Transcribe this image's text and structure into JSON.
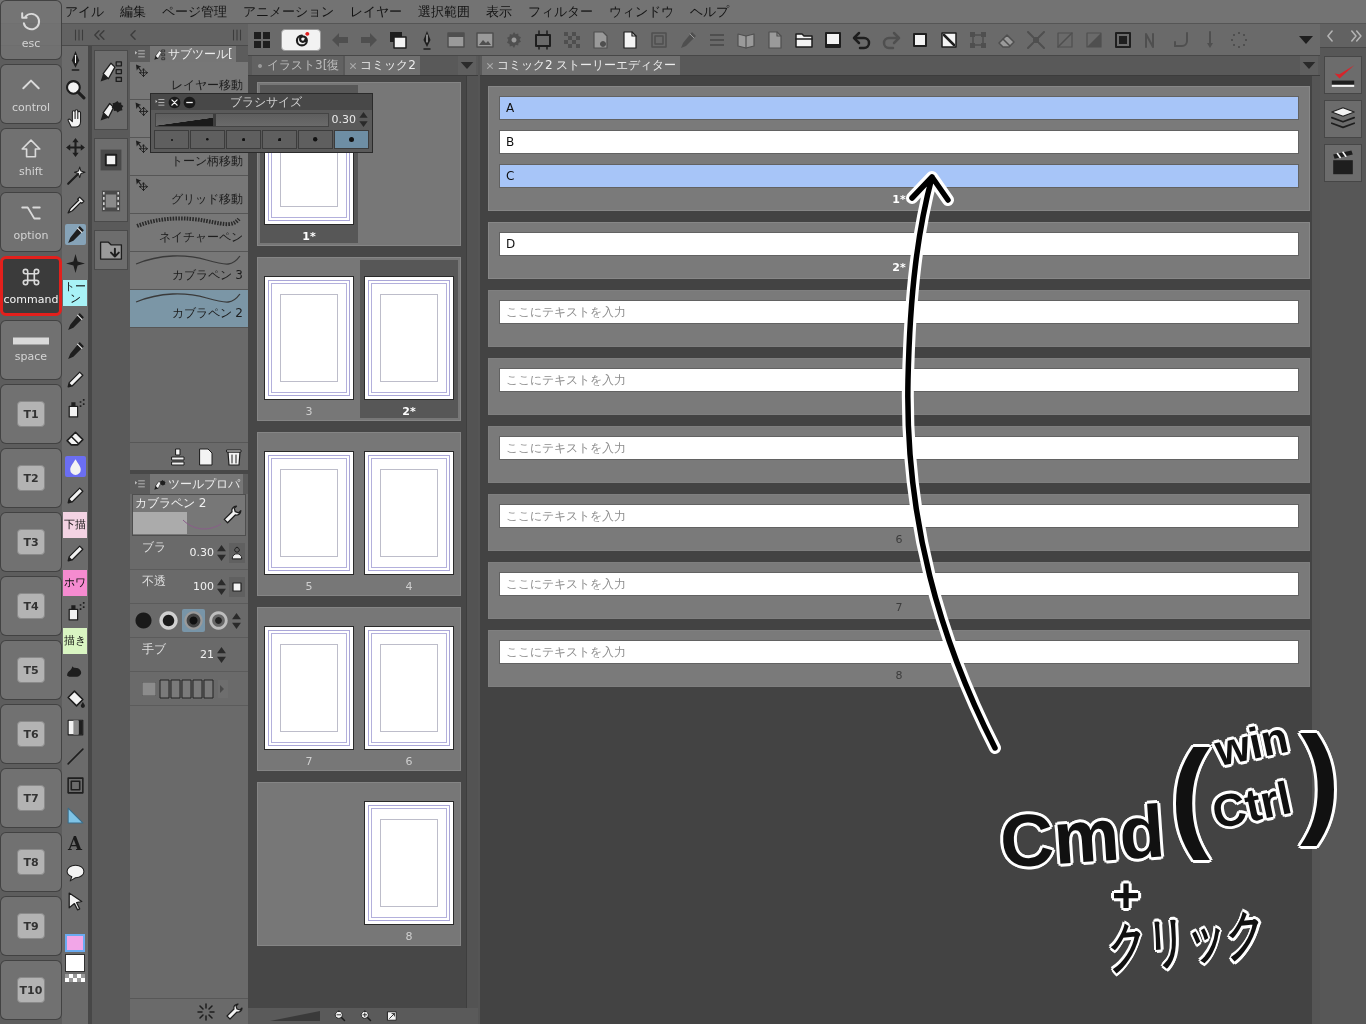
{
  "menu_bar": [
    "アイル",
    "編集",
    "ページ管理",
    "アニメーション",
    "レイヤー",
    "選択範囲",
    "表示",
    "フィルター",
    "ウィンドウ",
    "ヘルプ"
  ],
  "key_overlay": [
    {
      "kind": "esc",
      "label": "esc",
      "pressed": false
    },
    {
      "kind": "control",
      "label": "control",
      "pressed": false
    },
    {
      "kind": "shift",
      "label": "shift",
      "pressed": false
    },
    {
      "kind": "option",
      "label": "option",
      "pressed": false
    },
    {
      "kind": "command",
      "label": "command",
      "pressed": true
    },
    {
      "kind": "space",
      "label": "space",
      "pressed": false
    },
    {
      "kind": "slot",
      "label": "T1",
      "pressed": false
    },
    {
      "kind": "slot",
      "label": "T2",
      "pressed": false
    },
    {
      "kind": "slot",
      "label": "T3",
      "pressed": false
    },
    {
      "kind": "slot",
      "label": "T4",
      "pressed": false
    },
    {
      "kind": "slot",
      "label": "T5",
      "pressed": false
    },
    {
      "kind": "slot",
      "label": "T6",
      "pressed": false
    },
    {
      "kind": "slot",
      "label": "T7",
      "pressed": false
    },
    {
      "kind": "slot",
      "label": "T8",
      "pressed": false
    },
    {
      "kind": "slot",
      "label": "T9",
      "pressed": false
    },
    {
      "kind": "slot",
      "label": "T10",
      "pressed": false
    }
  ],
  "toolbar": [
    {
      "kind": "grid",
      "disabled": false
    },
    {
      "kind": "logo",
      "disabled": false
    },
    {
      "kind": "back-arrow",
      "disabled": true
    },
    {
      "kind": "forward-arrow",
      "disabled": true
    },
    {
      "kind": "stacked-windows",
      "disabled": false
    },
    {
      "kind": "nib",
      "disabled": false
    },
    {
      "kind": "window",
      "disabled": true
    },
    {
      "kind": "picture",
      "disabled": true
    },
    {
      "kind": "cog",
      "disabled": true
    },
    {
      "kind": "crop",
      "disabled": false
    },
    {
      "kind": "checker",
      "disabled": true
    },
    {
      "kind": "page-cog",
      "disabled": true
    },
    {
      "kind": "page",
      "disabled": false
    },
    {
      "kind": "frame",
      "disabled": true
    },
    {
      "kind": "pen",
      "disabled": true
    },
    {
      "kind": "list",
      "disabled": true
    },
    {
      "kind": "book",
      "disabled": true
    },
    {
      "kind": "page",
      "disabled": true
    },
    {
      "kind": "folder",
      "disabled": false
    },
    {
      "kind": "tray",
      "disabled": false
    },
    {
      "kind": "undo",
      "disabled": false
    },
    {
      "kind": "redo",
      "disabled": true
    },
    {
      "kind": "square",
      "disabled": false
    },
    {
      "kind": "diagonal-square",
      "disabled": false
    },
    {
      "kind": "corner-handles",
      "disabled": true
    },
    {
      "kind": "eraser",
      "disabled": true
    },
    {
      "kind": "expand-arrows",
      "disabled": true
    },
    {
      "kind": "slash-square",
      "disabled": true
    },
    {
      "kind": "half-square",
      "disabled": true
    },
    {
      "kind": "dotted-square",
      "disabled": false
    },
    {
      "kind": "zigzag",
      "disabled": true
    },
    {
      "kind": "hook",
      "disabled": true
    },
    {
      "kind": "down-arrow",
      "disabled": true
    },
    {
      "kind": "dot-ring",
      "disabled": true
    },
    {
      "kind": "caret",
      "disabled": false
    }
  ],
  "tool_palette": [
    {
      "kind": "nib",
      "selected": false
    },
    {
      "kind": "magnifier",
      "selected": false
    },
    {
      "kind": "hand",
      "selected": false
    },
    {
      "kind": "move-arrows",
      "selected": false
    },
    {
      "kind": "wand",
      "selected": false
    },
    {
      "kind": "dropper",
      "selected": false
    },
    {
      "kind": "pen",
      "selected": true
    },
    {
      "kind": "sparkle",
      "selected": false
    },
    {
      "kind": "tile",
      "text": "トーン",
      "color": "#a8f2f6",
      "selected": false
    },
    {
      "kind": "pen",
      "selected": false
    },
    {
      "kind": "pen",
      "selected": false
    },
    {
      "kind": "pencil",
      "selected": false
    },
    {
      "kind": "spray-can",
      "selected": false
    },
    {
      "kind": "eraser",
      "selected": false
    },
    {
      "kind": "water-drop",
      "selected": false
    },
    {
      "kind": "pencil",
      "selected": false
    },
    {
      "kind": "tile",
      "text": "下描",
      "color": "#f3d3e3",
      "selected": false
    },
    {
      "kind": "pencil",
      "selected": false
    },
    {
      "kind": "tile",
      "text": "ホワ",
      "color": "#f58bd0",
      "selected": false
    },
    {
      "kind": "spray-can",
      "selected": false
    },
    {
      "kind": "tile",
      "text": "描き",
      "color": "#d9f5c2",
      "selected": false
    },
    {
      "kind": "blob",
      "selected": false
    },
    {
      "kind": "bucket",
      "selected": false
    },
    {
      "kind": "gradient",
      "selected": false
    },
    {
      "kind": "line",
      "selected": false
    },
    {
      "kind": "frame",
      "selected": false
    },
    {
      "kind": "ruler",
      "selected": false
    },
    {
      "kind": "letter",
      "text": "A",
      "selected": false
    },
    {
      "kind": "balloon",
      "selected": false
    },
    {
      "kind": "pointer",
      "selected": false
    }
  ],
  "color_swatches": [
    {
      "color": "#f2a6e8",
      "selected": true
    },
    {
      "color": "#ffffff",
      "selected": false
    }
  ],
  "subtool_panel": {
    "title": "サブツール[",
    "items": [
      {
        "kind": "move",
        "label": "レイヤー移動",
        "selected": false
      },
      {
        "kind": "move",
        "selected": false
      },
      {
        "kind": "move",
        "label": "トーン柄移動",
        "selected": false
      },
      {
        "kind": "move",
        "label": "グリッド移動",
        "selected": false
      },
      {
        "kind": "textured",
        "label": "ネイチャーペン",
        "selected": false
      },
      {
        "kind": "stroke",
        "label": "カブラペン 3",
        "selected": false
      },
      {
        "kind": "stroke",
        "label": "カブラペン 2",
        "selected": true
      }
    ]
  },
  "brush_size_popup": {
    "title": "ブラシサイズ",
    "level": 0.35,
    "value": "0.30",
    "presets": [
      {
        "selected": false
      },
      {
        "selected": false
      },
      {
        "selected": false
      },
      {
        "selected": false
      },
      {
        "selected": false
      },
      {
        "selected": true
      }
    ]
  },
  "tool_property": {
    "title": "ツールプロパ",
    "preset": "カブラペン 2",
    "rows": [
      {
        "kind": "size",
        "label": "ブラ",
        "value": "0.30"
      },
      {
        "kind": "opacity",
        "label": "不透",
        "value": "100"
      },
      {
        "kind": "tips",
        "tips": [
          {
            "selected": false
          },
          {
            "selected": false
          },
          {
            "selected": true
          },
          {
            "selected": false
          }
        ]
      },
      {
        "kind": "stabilization",
        "label": "手ブ",
        "value": "21"
      },
      {
        "kind": "texture"
      }
    ]
  },
  "page_panel": {
    "tabs": [
      {
        "label": "イラスト3[復",
        "modified": true,
        "selected": false
      },
      {
        "label": "コミック2",
        "modified": false,
        "selected": true
      }
    ],
    "spreads": [
      {
        "left": {
          "label": "1*",
          "selected": true
        }
      },
      {
        "left": {
          "label": "3",
          "selected": false
        },
        "right": {
          "label": "2*",
          "selected": true
        }
      },
      {
        "left": {
          "label": "5",
          "selected": false
        },
        "right": {
          "label": "4",
          "selected": false
        }
      },
      {
        "left": {
          "label": "7",
          "selected": false
        },
        "right": {
          "label": "6",
          "selected": false
        }
      },
      {
        "right": {
          "label": "8",
          "selected": false
        }
      }
    ]
  },
  "story_editor": {
    "tab": {
      "label": "コミック2 ストーリーエディター",
      "modified": false,
      "selected": true
    },
    "pages": [
      {
        "label": "1*",
        "selected": true,
        "fields": [
          {
            "value": "A",
            "selected": true
          },
          {
            "value": "B",
            "selected": false
          },
          {
            "value": "C",
            "selected": true
          }
        ]
      },
      {
        "label": "2*",
        "selected": true,
        "fields": [
          {
            "value": "D",
            "selected": false
          }
        ]
      },
      {
        "selected": false,
        "fields": [
          {
            "placeholder": "ここにテキストを入力",
            "selected": false
          }
        ]
      },
      {
        "selected": false,
        "fields": [
          {
            "placeholder": "ここにテキストを入力",
            "selected": false
          }
        ]
      },
      {
        "selected": false,
        "fields": [
          {
            "placeholder": "ここにテキストを入力",
            "selected": false
          }
        ]
      },
      {
        "label": "6",
        "selected": false,
        "fields": [
          {
            "placeholder": "ここにテキストを入力",
            "selected": false
          }
        ]
      },
      {
        "label": "7",
        "selected": false,
        "fields": [
          {
            "placeholder": "ここにテキストを入力",
            "selected": false
          }
        ]
      },
      {
        "label": "8",
        "selected": false,
        "fields": [
          {
            "placeholder": "ここにテキストを入力",
            "selected": false
          }
        ]
      }
    ]
  },
  "annotation": {
    "key": "Cmd",
    "open": "(",
    "alt_top": "win",
    "alt_bottom": "Ctrl",
    "close": ")",
    "plus": "+",
    "action": "クリック"
  }
}
